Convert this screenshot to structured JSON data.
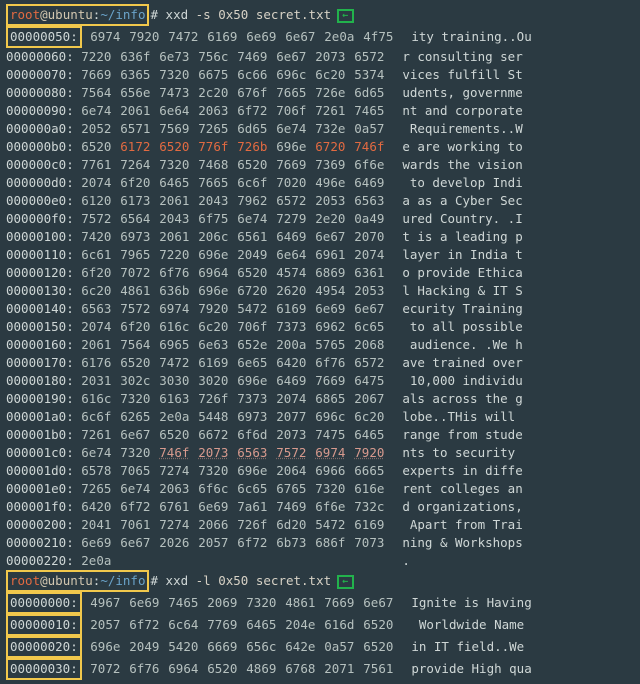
{
  "prompt1": {
    "user": "root",
    "at": "@",
    "host": "ubuntu",
    "colon": ":",
    "path": "~/info",
    "hash": "#",
    "cmd": "xxd",
    "args": "-s 0x50 secret.txt"
  },
  "prompt2": {
    "user": "root",
    "at": "@",
    "host": "ubuntu",
    "colon": ":",
    "path": "~/info",
    "hash": "#",
    "cmd": "xxd",
    "args": "-l 0x50 secret.txt"
  },
  "block1": [
    {
      "off": "00000050:",
      "hex": [
        "6974",
        "7920",
        "7472",
        "6169",
        "6e69",
        "6e67",
        "2e0a",
        "4f75"
      ],
      "txt": "ity training..Ou",
      "hl_off": true
    },
    {
      "off": "00000060:",
      "hex": [
        "7220",
        "636f",
        "6e73",
        "756c",
        "7469",
        "6e67",
        "2073",
        "6572"
      ],
      "txt": "r consulting ser"
    },
    {
      "off": "00000070:",
      "hex": [
        "7669",
        "6365",
        "7320",
        "6675",
        "6c66",
        "696c",
        "6c20",
        "5374"
      ],
      "txt": "vices fulfill St"
    },
    {
      "off": "00000080:",
      "hex": [
        "7564",
        "656e",
        "7473",
        "2c20",
        "676f",
        "7665",
        "726e",
        "6d65"
      ],
      "txt": "udents, governme"
    },
    {
      "off": "00000090:",
      "hex": [
        "6e74",
        "2061",
        "6e64",
        "2063",
        "6f72",
        "706f",
        "7261",
        "7465"
      ],
      "txt": "nt and corporate"
    },
    {
      "off": "000000a0:",
      "hex": [
        "2052",
        "6571",
        "7569",
        "7265",
        "6d65",
        "6e74",
        "732e",
        "0a57"
      ],
      "txt": " Requirements..W"
    },
    {
      "off": "000000b0:",
      "hex": [
        "6520",
        "6172",
        "6520",
        "776f",
        "726b",
        "696e",
        "6720",
        "746f"
      ],
      "txt": "e are working to",
      "hi1": [
        1,
        2,
        3,
        4,
        6,
        7
      ]
    },
    {
      "off": "000000c0:",
      "hex": [
        "7761",
        "7264",
        "7320",
        "7468",
        "6520",
        "7669",
        "7369",
        "6f6e"
      ],
      "txt": "wards the vision"
    },
    {
      "off": "000000d0:",
      "hex": [
        "2074",
        "6f20",
        "6465",
        "7665",
        "6c6f",
        "7020",
        "496e",
        "6469"
      ],
      "txt": " to develop Indi"
    },
    {
      "off": "000000e0:",
      "hex": [
        "6120",
        "6173",
        "2061",
        "2043",
        "7962",
        "6572",
        "2053",
        "6563"
      ],
      "txt": "a as a Cyber Sec"
    },
    {
      "off": "000000f0:",
      "hex": [
        "7572",
        "6564",
        "2043",
        "6f75",
        "6e74",
        "7279",
        "2e20",
        "0a49"
      ],
      "txt": "ured Country. .I"
    },
    {
      "off": "00000100:",
      "hex": [
        "7420",
        "6973",
        "2061",
        "206c",
        "6561",
        "6469",
        "6e67",
        "2070"
      ],
      "txt": "t is a leading p"
    },
    {
      "off": "00000110:",
      "hex": [
        "6c61",
        "7965",
        "7220",
        "696e",
        "2049",
        "6e64",
        "6961",
        "2074"
      ],
      "txt": "layer in India t"
    },
    {
      "off": "00000120:",
      "hex": [
        "6f20",
        "7072",
        "6f76",
        "6964",
        "6520",
        "4574",
        "6869",
        "6361"
      ],
      "txt": "o provide Ethica"
    },
    {
      "off": "00000130:",
      "hex": [
        "6c20",
        "4861",
        "636b",
        "696e",
        "6720",
        "2620",
        "4954",
        "2053"
      ],
      "txt": "l Hacking & IT S"
    },
    {
      "off": "00000140:",
      "hex": [
        "6563",
        "7572",
        "6974",
        "7920",
        "5472",
        "6169",
        "6e69",
        "6e67"
      ],
      "txt": "ecurity Training"
    },
    {
      "off": "00000150:",
      "hex": [
        "2074",
        "6f20",
        "616c",
        "6c20",
        "706f",
        "7373",
        "6962",
        "6c65"
      ],
      "txt": " to all possible"
    },
    {
      "off": "00000160:",
      "hex": [
        "2061",
        "7564",
        "6965",
        "6e63",
        "652e",
        "200a",
        "5765",
        "2068"
      ],
      "txt": " audience. .We h"
    },
    {
      "off": "00000170:",
      "hex": [
        "6176",
        "6520",
        "7472",
        "6169",
        "6e65",
        "6420",
        "6f76",
        "6572"
      ],
      "txt": "ave trained over"
    },
    {
      "off": "00000180:",
      "hex": [
        "2031",
        "302c",
        "3030",
        "3020",
        "696e",
        "6469",
        "7669",
        "6475"
      ],
      "txt": " 10,000 individu"
    },
    {
      "off": "00000190:",
      "hex": [
        "616c",
        "7320",
        "6163",
        "726f",
        "7373",
        "2074",
        "6865",
        "2067"
      ],
      "txt": "als across the g"
    },
    {
      "off": "000001a0:",
      "hex": [
        "6c6f",
        "6265",
        "2e0a",
        "5448",
        "6973",
        "2077",
        "696c",
        "6c20"
      ],
      "txt": "lobe..THis will "
    },
    {
      "off": "000001b0:",
      "hex": [
        "7261",
        "6e67",
        "6520",
        "6672",
        "6f6d",
        "2073",
        "7475",
        "6465"
      ],
      "txt": "range from stude"
    },
    {
      "off": "000001c0:",
      "hex": [
        "6e74",
        "7320",
        "746f",
        "2073",
        "6563",
        "7572",
        "6974",
        "7920"
      ],
      "txt": "nts to security ",
      "hi2": [
        2,
        3,
        4,
        5,
        6,
        7
      ]
    },
    {
      "off": "000001d0:",
      "hex": [
        "6578",
        "7065",
        "7274",
        "7320",
        "696e",
        "2064",
        "6966",
        "6665"
      ],
      "txt": "experts in diffe"
    },
    {
      "off": "000001e0:",
      "hex": [
        "7265",
        "6e74",
        "2063",
        "6f6c",
        "6c65",
        "6765",
        "7320",
        "616e"
      ],
      "txt": "rent colleges an"
    },
    {
      "off": "000001f0:",
      "hex": [
        "6420",
        "6f72",
        "6761",
        "6e69",
        "7a61",
        "7469",
        "6f6e",
        "732c"
      ],
      "txt": "d organizations,"
    },
    {
      "off": "00000200:",
      "hex": [
        "2041",
        "7061",
        "7274",
        "2066",
        "726f",
        "6d20",
        "5472",
        "6169"
      ],
      "txt": " Apart from Trai"
    },
    {
      "off": "00000210:",
      "hex": [
        "6e69",
        "6e67",
        "2026",
        "2057",
        "6f72",
        "6b73",
        "686f",
        "7073"
      ],
      "txt": "ning & Workshops"
    },
    {
      "off": "00000220:",
      "hex": [
        "2e0a"
      ],
      "txt": "."
    }
  ],
  "block2": [
    {
      "off": "00000000:",
      "hex": [
        "4967",
        "6e69",
        "7465",
        "2069",
        "7320",
        "4861",
        "7669",
        "6e67"
      ],
      "txt": "Ignite is Having",
      "hl_off": true
    },
    {
      "off": "00000010:",
      "hex": [
        "2057",
        "6f72",
        "6c64",
        "7769",
        "6465",
        "204e",
        "616d",
        "6520"
      ],
      "txt": " Worldwide Name ",
      "hl_off": true
    },
    {
      "off": "00000020:",
      "hex": [
        "696e",
        "2049",
        "5420",
        "6669",
        "656c",
        "642e",
        "0a57",
        "6520"
      ],
      "txt": "in IT field..We ",
      "hl_off": true
    },
    {
      "off": "00000030:",
      "hex": [
        "7072",
        "6f76",
        "6964",
        "6520",
        "4869",
        "6768",
        "2071",
        "7561"
      ],
      "txt": "provide High qua",
      "hl_off": true
    }
  ]
}
